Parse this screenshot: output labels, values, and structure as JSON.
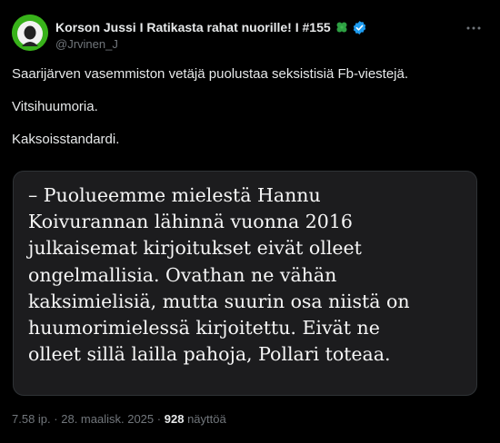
{
  "author": {
    "display_name": "Korson Jussi I Ratikasta rahat nuorille! I #155",
    "handle": "@Jrvinen_J",
    "emoji_icon": "four-leaf-clover-icon",
    "badge_icon": "verified-badge-icon",
    "badge_color": "#1d9bf0"
  },
  "tweet": {
    "paragraphs": [
      "Saarijärven vasemmiston vetäjä puolustaa seksistisiä Fb-viestejä.",
      "Vitsihuumoria.",
      "Kaksoisstandardi."
    ]
  },
  "quote_image": {
    "lines": [
      "– Puolueemme mielestä Hannu",
      "Koivurannan lähinnä vuonna 2016",
      "julkaisemat kirjoitukset eivät olleet",
      "ongelmallisia. Ovathan ne vähän",
      "kaksimielisiä, mutta suurin osa niistä on",
      "huumorimielessä kirjoitettu. Eivät ne",
      "olleet sillä lailla pahoja, Pollari toteaa."
    ]
  },
  "meta": {
    "time": "7.58 ip.",
    "separator": "·",
    "date": "28. maalisk. 2025",
    "views_count": "928",
    "views_label": "näyttöä"
  },
  "colors": {
    "background": "#000000",
    "text": "#e7e9ea",
    "secondary": "#71767b",
    "card": "#1c1c1e",
    "avatar": "#38b21a"
  }
}
